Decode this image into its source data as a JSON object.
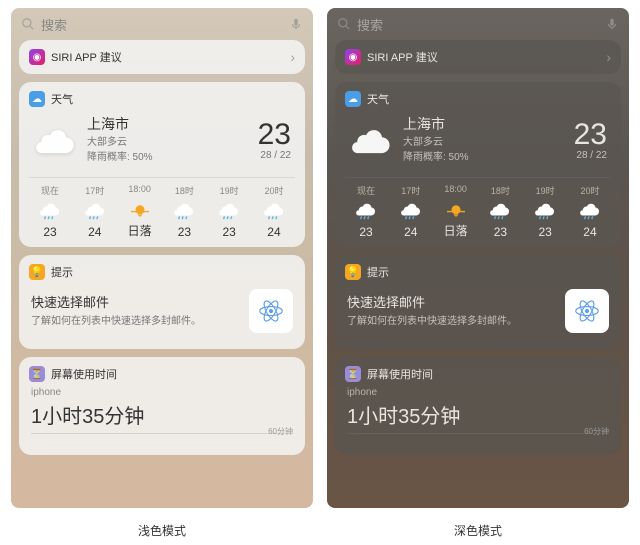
{
  "search": {
    "placeholder": "搜索"
  },
  "siri": {
    "title": "SIRI APP 建议"
  },
  "weather": {
    "title": "天气",
    "city": "上海市",
    "condition": "大部多云",
    "rain": "降雨概率: 50%",
    "temp": "23",
    "range": "28 / 22",
    "hourly": [
      {
        "time": "现在",
        "icon": "rain",
        "val": "23"
      },
      {
        "time": "17时",
        "icon": "rain",
        "val": "24"
      },
      {
        "time": "18:00",
        "icon": "sunset",
        "val": "日落"
      },
      {
        "time": "18时",
        "icon": "rain",
        "val": "23"
      },
      {
        "time": "19时",
        "icon": "rain",
        "val": "23"
      },
      {
        "time": "20时",
        "icon": "rain",
        "val": "24"
      }
    ]
  },
  "tips": {
    "title": "提示",
    "heading": "快速选择邮件",
    "desc": "了解如何在列表中快速选择多封邮件。"
  },
  "screentime": {
    "title": "屏幕使用时间",
    "device": "iphone",
    "duration": "1小时35分钟",
    "marker": "60分钟"
  },
  "labels": {
    "light": "浅色模式",
    "dark": "深色模式"
  }
}
